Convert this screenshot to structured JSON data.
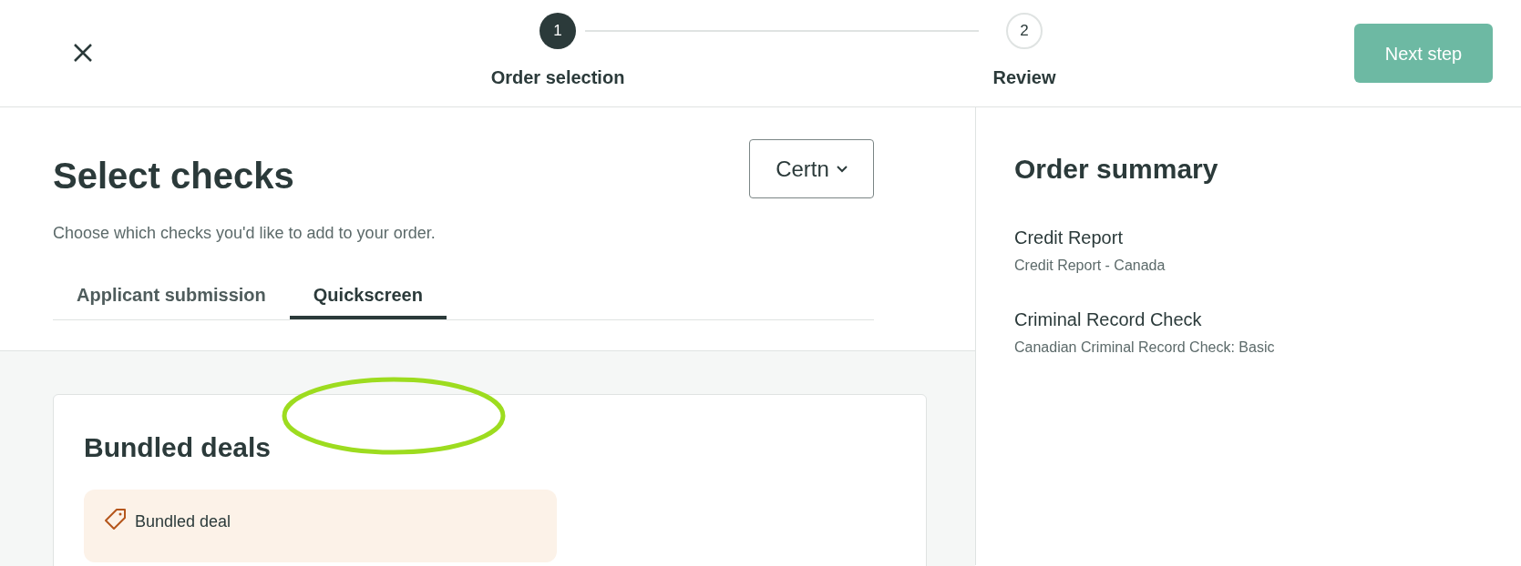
{
  "header": {
    "steps": [
      {
        "number": "1",
        "label": "Order selection",
        "selected": true
      },
      {
        "number": "2",
        "label": "Review",
        "selected": false
      }
    ],
    "next_button": "Next step"
  },
  "main": {
    "title": "Select checks",
    "dropdown": "Certn",
    "subtitle": "Choose which checks you'd like to add to your order.",
    "tabs": [
      {
        "label": "Applicant submission",
        "selected": false
      },
      {
        "label": "Quickscreen",
        "selected": true
      }
    ],
    "card": {
      "title": "Bundled deals",
      "deal_label": "Bundled deal"
    }
  },
  "summary": {
    "title": "Order summary",
    "items": [
      {
        "name": "Credit Report",
        "detail": "Credit Report - Canada"
      },
      {
        "name": "Criminal Record Check",
        "detail": "Canadian Criminal Record Check: Basic"
      }
    ]
  }
}
